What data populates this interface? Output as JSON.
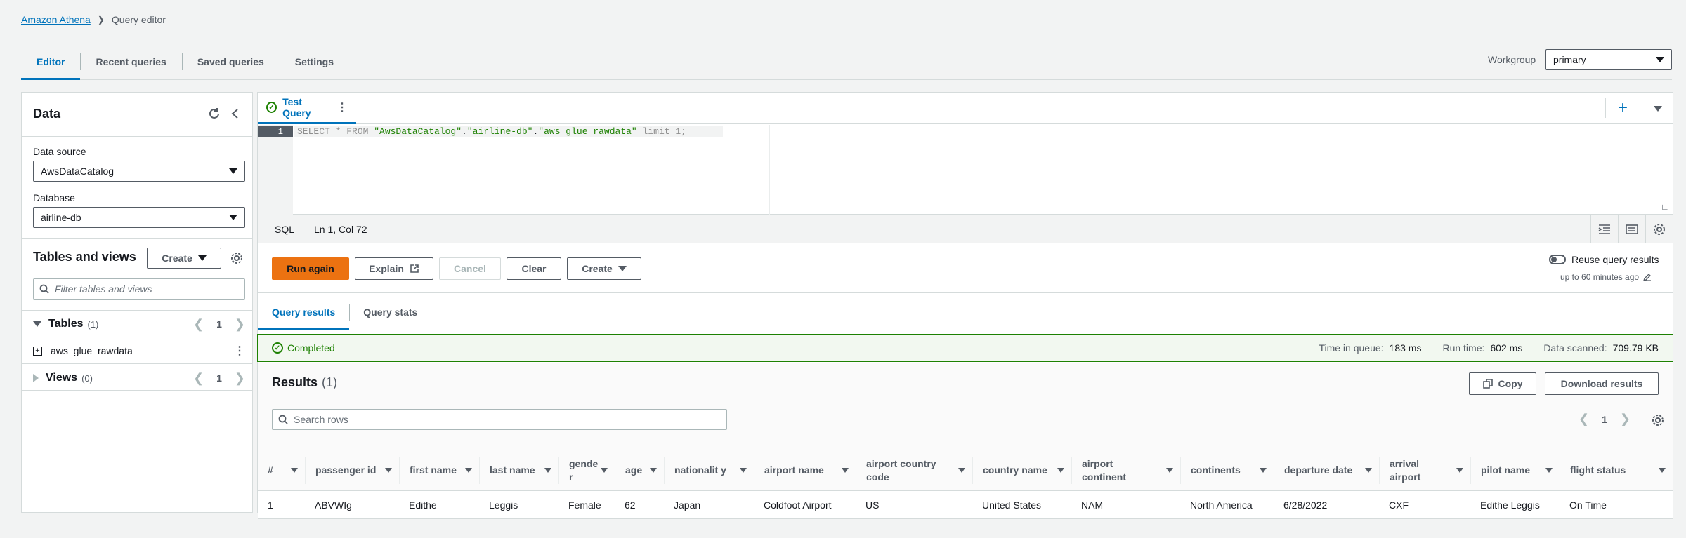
{
  "breadcrumb": {
    "root": "Amazon Athena",
    "current": "Query editor"
  },
  "top_tabs": [
    "Editor",
    "Recent queries",
    "Saved queries",
    "Settings"
  ],
  "workgroup": {
    "label": "Workgroup",
    "value": "primary"
  },
  "data_panel": {
    "title": "Data",
    "data_source_label": "Data source",
    "data_source_value": "AwsDataCatalog",
    "database_label": "Database",
    "database_value": "airline-db",
    "tables_views_title": "Tables and views",
    "create_label": "Create",
    "filter_placeholder": "Filter tables and views",
    "tables_label": "Tables",
    "tables_count": "(1)",
    "tables_page": "1",
    "table_item": "aws_glue_rawdata",
    "views_label": "Views",
    "views_count": "(0)",
    "views_page": "1"
  },
  "query_tab": {
    "name": "Test Query"
  },
  "editor": {
    "line_number": "1",
    "code_kw1": "SELECT * FROM ",
    "code_s1": "\"AwsDataCatalog\"",
    "code_d1": ".",
    "code_s2": "\"airline-db\"",
    "code_d2": ".",
    "code_s3": "\"aws_glue_rawdata\"",
    "code_kw2": " limit 1;"
  },
  "status": {
    "language": "SQL",
    "position": "Ln 1, Col 72"
  },
  "actions": {
    "run": "Run again",
    "explain": "Explain",
    "cancel": "Cancel",
    "clear": "Clear",
    "create": "Create",
    "reuse": "Reuse query results",
    "reuse_sub": "up to 60 minutes ago"
  },
  "result_tabs": [
    "Query results",
    "Query stats"
  ],
  "completion": {
    "status": "Completed",
    "queue_label": "Time in queue:",
    "queue_value": "183 ms",
    "run_label": "Run time:",
    "run_value": "602 ms",
    "scanned_label": "Data scanned:",
    "scanned_value": "709.79 KB"
  },
  "results": {
    "title": "Results",
    "count": "(1)",
    "copy": "Copy",
    "download": "Download results",
    "search_placeholder": "Search rows",
    "page": "1",
    "columns": [
      "#",
      "passenger id",
      "first name",
      "last name",
      "gende r",
      "age",
      "nationalit y",
      "airport name",
      "airport country code",
      "country name",
      "airport continent",
      "continents",
      "departure date",
      "arrival airport",
      "pilot name",
      "flight status"
    ],
    "rows": [
      [
        "1",
        "ABVWIg",
        "Edithe",
        "Leggis",
        "Female",
        "62",
        "Japan",
        "Coldfoot Airport",
        "US",
        "United States",
        "NAM",
        "North America",
        "6/28/2022",
        "CXF",
        "Edithe Leggis",
        "On Time"
      ]
    ]
  },
  "colors": {
    "accent": "#0073bb",
    "primary_button": "#ec7211",
    "success": "#1d8102"
  }
}
